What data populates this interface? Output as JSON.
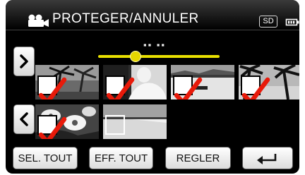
{
  "header": {
    "title": "PROTEGER/ANNULER",
    "storage_badge": "SD",
    "mode_icon": "movie-camera-icon",
    "battery_icon": "battery-icon"
  },
  "date_bar": {
    "label": "▪▪ ▪▪",
    "position_fraction": 0.3
  },
  "navigation": {
    "next_label": "›",
    "prev_label": "‹"
  },
  "thumbnails": [
    {
      "scene": "palm-trees",
      "checked": true
    },
    {
      "scene": "person-white",
      "checked": true
    },
    {
      "scene": "lake-boat",
      "checked": true
    },
    {
      "scene": "palm-silhouette",
      "checked": true
    },
    {
      "scene": "flowers",
      "checked": true
    },
    {
      "scene": "beach",
      "checked": false
    }
  ],
  "colors": {
    "check_red": "#e81a0a",
    "slider_yellow": "#e8e000"
  },
  "buttons": {
    "select_all": "SEL. TOUT",
    "clear_all": "EFF. TOUT",
    "set": "REGLER",
    "back": "↵"
  }
}
